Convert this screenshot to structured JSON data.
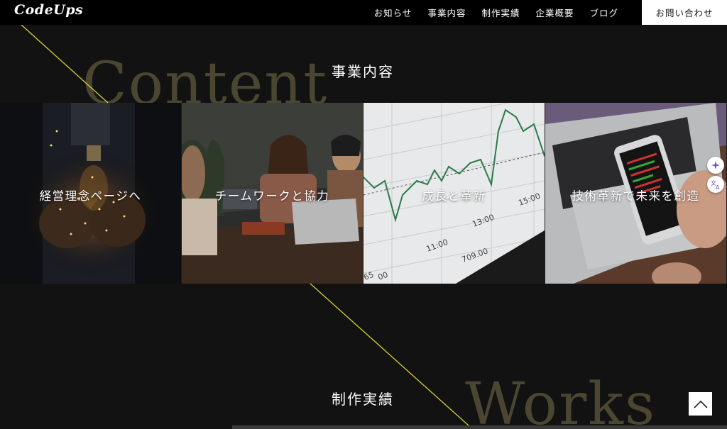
{
  "header": {
    "logo": "CodeUps",
    "nav": [
      "お知らせ",
      "事業内容",
      "制作実績",
      "企業概要",
      "ブログ"
    ],
    "contact_label": "お問い合わせ"
  },
  "content_section": {
    "bg_word": "Content",
    "title": "事業内容",
    "cards": [
      {
        "label": "経営理念ページへ",
        "image": "lightbulb-hands-photo"
      },
      {
        "label": "チームワークと協力",
        "image": "team-meeting-photo"
      },
      {
        "label": "成長と革新",
        "image": "stock-chart-photo"
      },
      {
        "label": "技術革新で未来を創造",
        "image": "laptop-phone-photo"
      }
    ],
    "chart_photo_labels": [
      "13:00",
      "11:00",
      "15:00",
      "709.00",
      "65",
      "00"
    ]
  },
  "works_section": {
    "bg_word": "Works",
    "title": "制作実績"
  },
  "widgets": {
    "ai_icon": "sparkle-icon",
    "translate_icon": "translate-icon",
    "back_to_top_icon": "chevron-up-icon"
  },
  "colors": {
    "background": "#121212",
    "header": "#000000",
    "accent_line": "#d8cf3a",
    "bg_word": "#4a4632"
  }
}
